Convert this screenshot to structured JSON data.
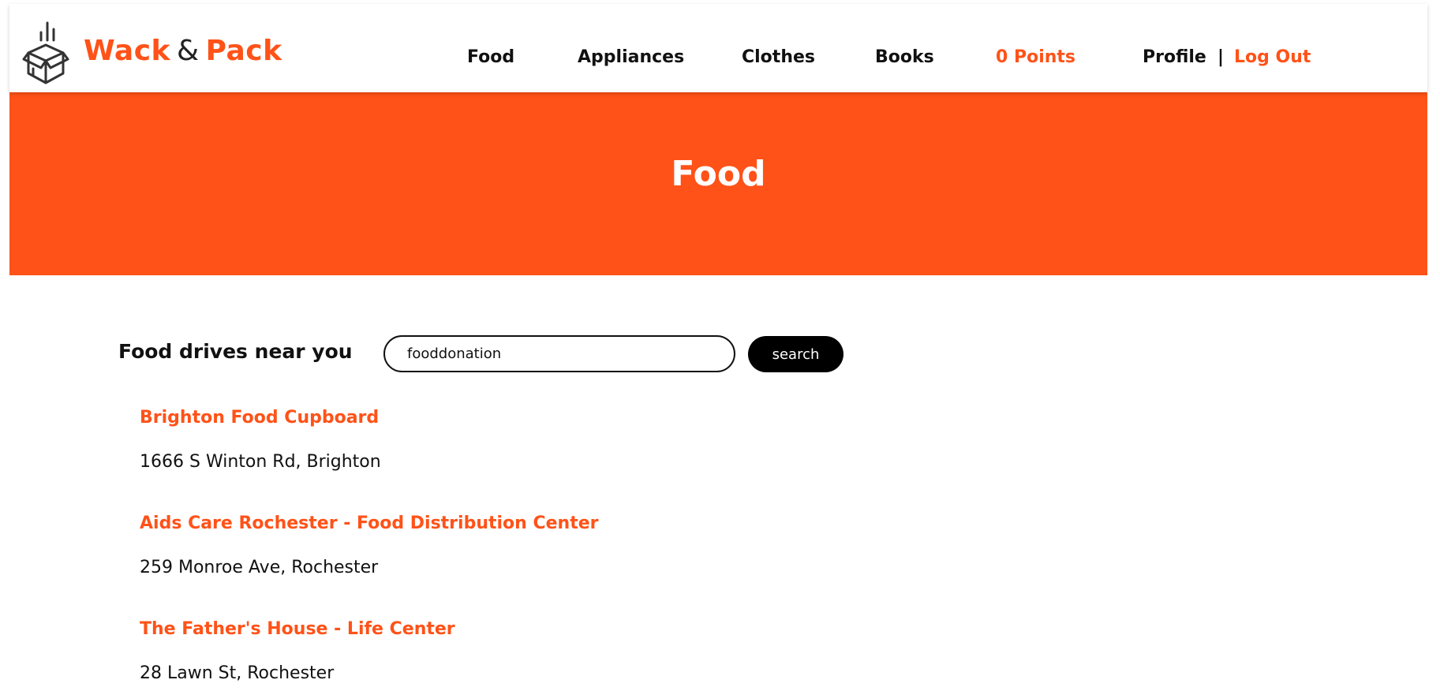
{
  "brand": {
    "word1": "Wack",
    "amp": "&",
    "word2": "Pack",
    "logo_icon": "box-icon"
  },
  "nav": {
    "food": "Food",
    "appliances": "Appliances",
    "clothes": "Clothes",
    "books": "Books",
    "points": "0 Points",
    "profile": "Profile",
    "separator": "|",
    "logout": "Log Out"
  },
  "hero": {
    "title": "Food"
  },
  "search": {
    "label": "Food drives near you",
    "value": "fooddonation",
    "button": "search"
  },
  "results": [
    {
      "name": "Brighton Food Cupboard",
      "address": "1666 S Winton Rd, Brighton"
    },
    {
      "name": "Aids Care Rochester - Food Distribution Center",
      "address": "259 Monroe Ave, Rochester"
    },
    {
      "name": "The Father's House - Life Center",
      "address": "28 Lawn St, Rochester"
    }
  ],
  "colors": {
    "accent": "#ff5218",
    "text": "#111111",
    "button_bg": "#000000"
  }
}
